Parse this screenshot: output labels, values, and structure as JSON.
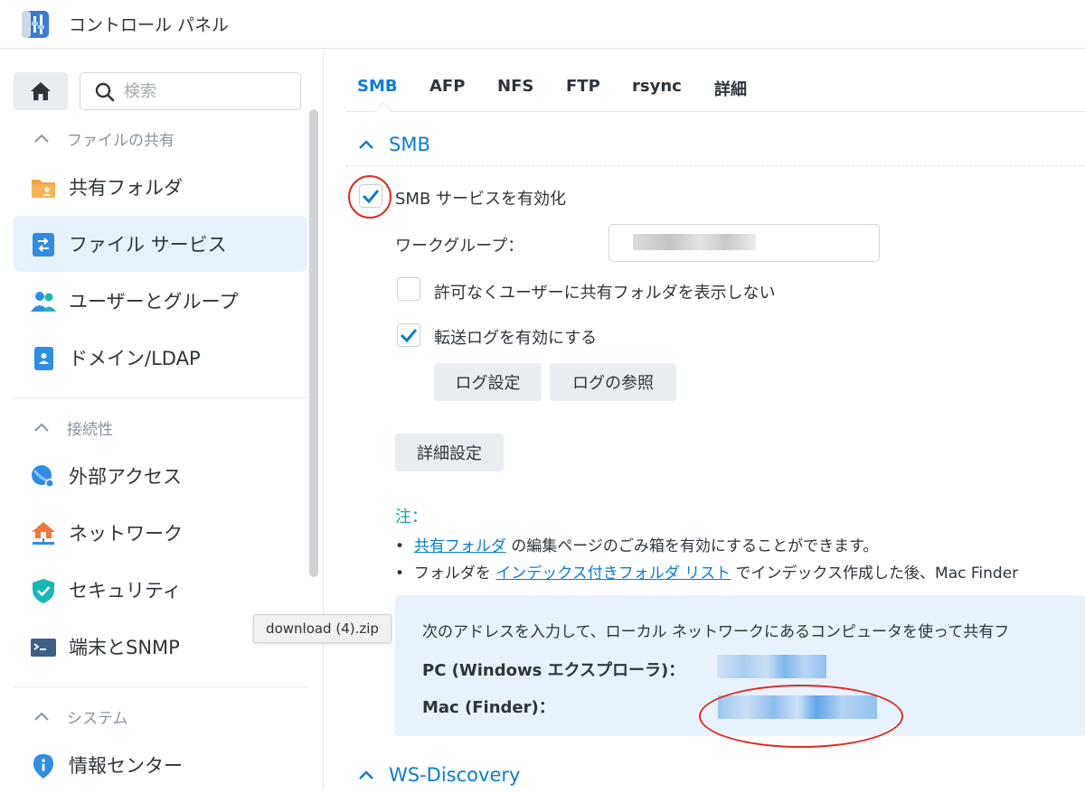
{
  "titlebar": {
    "title": "コントロール パネル"
  },
  "sidebar": {
    "search_placeholder": "検索",
    "sections": [
      {
        "label": "ファイルの共有"
      },
      {
        "label": "接続性"
      },
      {
        "label": "システム"
      }
    ],
    "items": [
      {
        "label": "共有フォルダ"
      },
      {
        "label": "ファイル サービス"
      },
      {
        "label": "ユーザーとグループ"
      },
      {
        "label": "ドメイン/LDAP"
      },
      {
        "label": "外部アクセス"
      },
      {
        "label": "ネットワーク"
      },
      {
        "label": "セキュリティ"
      },
      {
        "label": "端末とSNMP"
      },
      {
        "label": "情報センター"
      }
    ],
    "active_item": "ファイル サービス"
  },
  "tooltip": {
    "text": "download (4).zip"
  },
  "tabs": [
    {
      "label": "SMB"
    },
    {
      "label": "AFP"
    },
    {
      "label": "NFS"
    },
    {
      "label": "FTP"
    },
    {
      "label": "rsync"
    },
    {
      "label": "詳細"
    }
  ],
  "active_tab": "SMB",
  "smb": {
    "section_title": "SMB",
    "enable_label": "SMB サービスを有効化",
    "enable_checked": true,
    "workgroup_label": "ワークグループ：",
    "hide_shares_label": "許可なくユーザーに共有フォルダを表示しない",
    "hide_shares_checked": false,
    "transfer_log_label": "転送ログを有効にする",
    "transfer_log_checked": true,
    "log_settings_button": "ログ設定",
    "view_logs_button": "ログの参照",
    "advanced_button": "詳細設定",
    "note_title": "注：",
    "note1_link": "共有フォルダ",
    "note1_text": " の編集ページのごみ箱を有効にすることができます。",
    "note2_prefix": "フォルダを ",
    "note2_link": "インデックス付きフォルダ リスト",
    "note2_suffix": " でインデックス作成した後、Mac Finder",
    "info_text": "次のアドレスを入力して、ローカル ネットワークにあるコンピュータを使って共有フ",
    "pc_label": "PC (Windows エクスプローラ)：",
    "mac_label": "Mac (Finder)："
  },
  "ws_discovery": {
    "section_title": "WS-Discovery"
  },
  "colors": {
    "accent": "#0a7cd8",
    "note": "#16a3a0",
    "annotation": "#e02a1f",
    "active_bg": "#e7f1fc"
  },
  "icons": [
    "control-panel-icon",
    "home-icon",
    "search-icon",
    "folder-icon",
    "file-services-icon",
    "users-icon",
    "domain-icon",
    "external-access-icon",
    "network-icon",
    "security-icon",
    "terminal-icon",
    "info-icon",
    "chevron-up-icon",
    "checkmark-icon"
  ]
}
